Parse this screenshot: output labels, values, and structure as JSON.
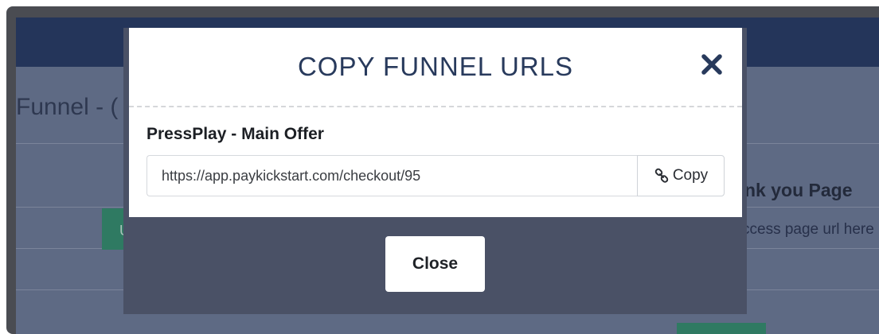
{
  "background_page": {
    "title": "Funnel - (",
    "upsell_button_label": "Up",
    "right_column_title": "nk you Page",
    "right_column_placeholder": "ccess page url here"
  },
  "modal": {
    "title": "COPY FUNNEL URLS",
    "close_icon": "close-x-icon",
    "offer": {
      "label": "PressPlay - Main Offer",
      "url": "https://app.paykickstart.com/checkout/95",
      "copy_label": "Copy",
      "copy_icon": "link-icon"
    },
    "close_button_label": "Close"
  },
  "colors": {
    "modal_title": "#283a5c",
    "topbar": "#24355a",
    "overlay": "#5e6a84",
    "green_button": "#2f7a62"
  }
}
